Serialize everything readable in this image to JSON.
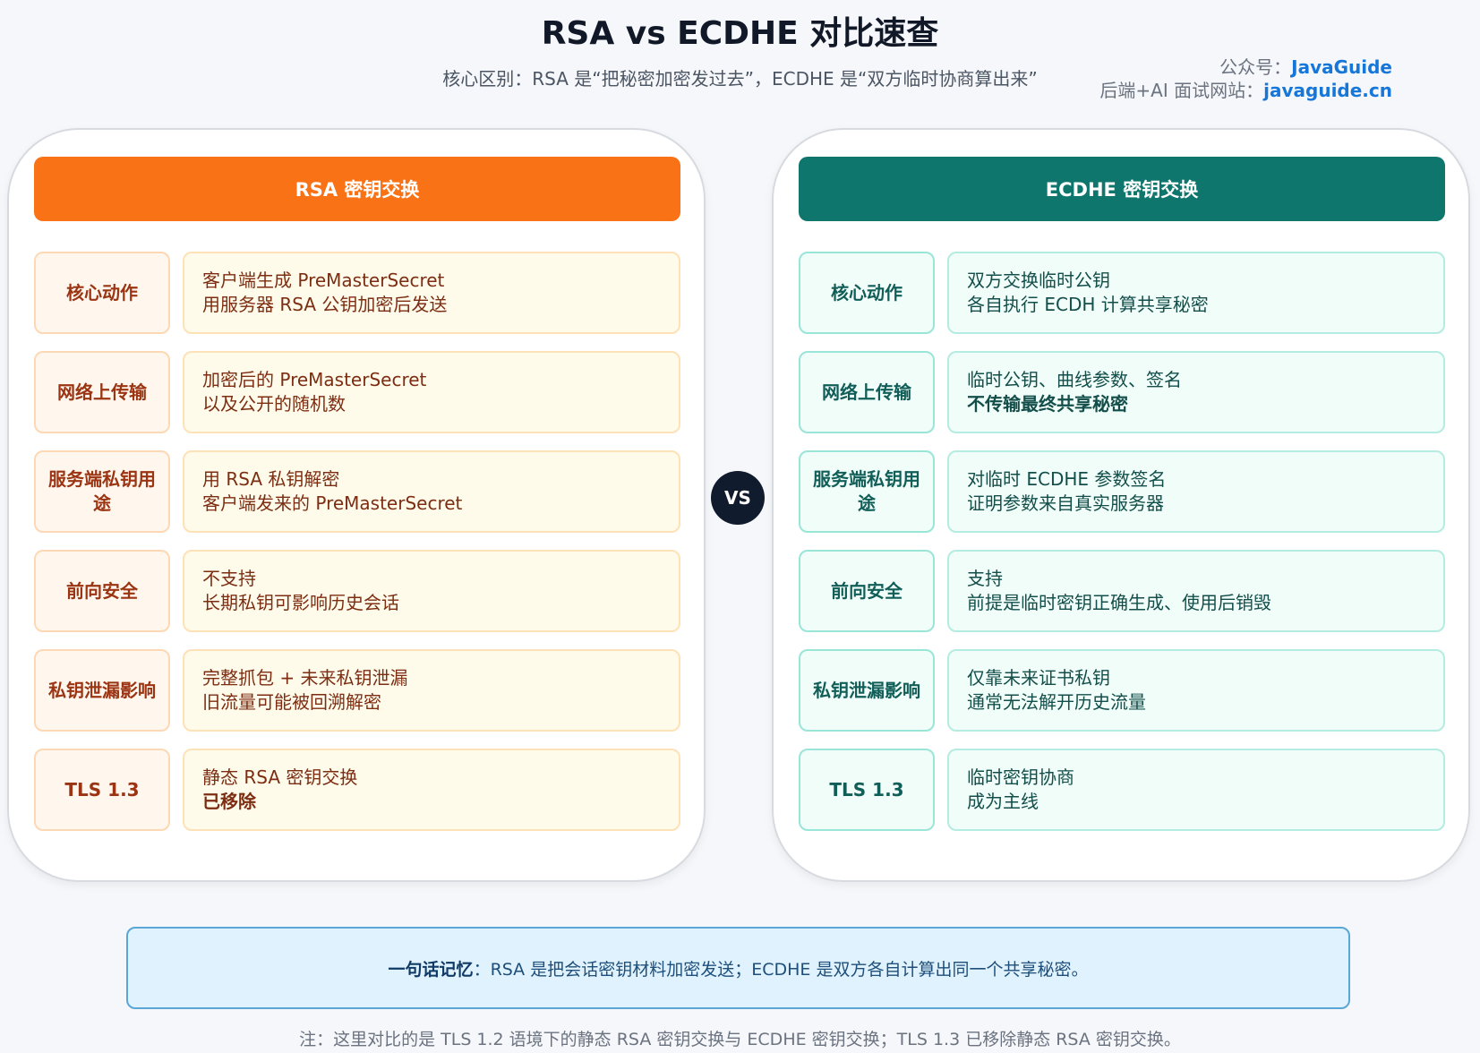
{
  "title": "RSA vs ECDHE 对比速查",
  "subtitle": "核心区别：RSA 是“把秘密加密发过去”，ECDHE 是“双方临时协商算出来”",
  "credit": {
    "line1_label": "公众号：",
    "line1_link": "JavaGuide",
    "line2_label": "后端+AI 面试网站：",
    "line2_link": "javaguide.cn"
  },
  "vs_label": "VS",
  "rsa": {
    "header": "RSA 密钥交换",
    "rows": [
      {
        "label": "核心动作",
        "line1": "客户端生成 PreMasterSecret",
        "line2": "用服务器 RSA 公钥加密后发送"
      },
      {
        "label": "网络上传输",
        "line1": "加密后的 PreMasterSecret",
        "line2": "以及公开的随机数"
      },
      {
        "label": "服务端私钥用途",
        "line1": "用 RSA 私钥解密",
        "line2": "客户端发来的 PreMasterSecret"
      },
      {
        "label": "前向安全",
        "line1": "不支持",
        "line2": "长期私钥可影响历史会话"
      },
      {
        "label": "私钥泄漏影响",
        "line1": "完整抓包 + 未来私钥泄漏",
        "line2": "旧流量可能被回溯解密"
      },
      {
        "label": "TLS 1.3",
        "line1": "静态 RSA 密钥交换",
        "line2": "已移除"
      }
    ]
  },
  "ecdhe": {
    "header": "ECDHE 密钥交换",
    "rows": [
      {
        "label": "核心动作",
        "line1": "双方交换临时公钥",
        "line2": "各自执行 ECDH 计算共享秘密"
      },
      {
        "label": "网络上传输",
        "line1": "临时公钥、曲线参数、签名",
        "line2": "不传输最终共享秘密"
      },
      {
        "label": "服务端私钥用途",
        "line1": "对临时 ECDHE 参数签名",
        "line2": "证明参数来自真实服务器"
      },
      {
        "label": "前向安全",
        "line1": "支持",
        "line2": "前提是临时密钥正确生成、使用后销毁"
      },
      {
        "label": "私钥泄漏影响",
        "line1": "仅靠未来证书私钥",
        "line2": "通常无法解开历史流量"
      },
      {
        "label": "TLS 1.3",
        "line1": "临时密钥协商",
        "line2": "成为主线"
      }
    ]
  },
  "memo": {
    "lead": "一句话记忆",
    "text": "：RSA 是把会话密钥材料加密发送；ECDHE 是双方各自计算出同一个共享秘密。"
  },
  "note": "注：这里对比的是 TLS 1.2 语境下的静态 RSA 密钥交换与 ECDHE 密钥交换；TLS 1.3 已移除静态 RSA 密钥交换。"
}
